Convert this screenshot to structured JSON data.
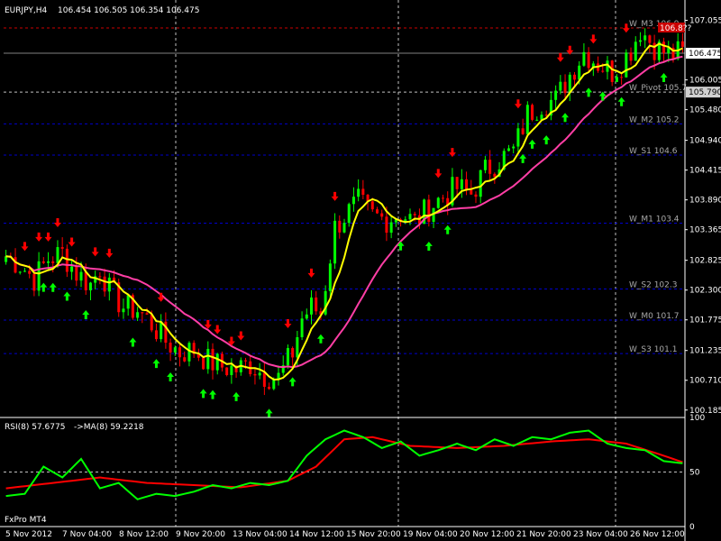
{
  "header": {
    "symbol": "EURJPY,H4",
    "ohlc": "106.454 106.505 106.354 106.475"
  },
  "rsi_panel": {
    "label": "RSI(8) 57.6775",
    "ma_label": "->MA(8) 59.2218",
    "scale": [
      "100",
      "50",
      "0"
    ]
  },
  "watermark": "FxPro MT4",
  "colors": {
    "background": "#000000",
    "grid": "#c0c0c0",
    "level_line": "#0000cc",
    "red_level": "#cc0000",
    "bull_candle": "#00ff00",
    "bear_candle": "#ff0000",
    "fast_ma": "#ffff00",
    "slow_ma": "#ff3ea5",
    "rsi": "#00ff00",
    "rsi_ma": "#ff0000",
    "up_arrow": "#00ff00",
    "down_arrow": "#ff0000"
  },
  "chart_data": {
    "type": "candlestick",
    "price_axis_ticks": [
      "107.055",
      "106.005",
      "105.480",
      "104.940",
      "104.415",
      "103.890",
      "103.365",
      "102.825",
      "102.300",
      "101.775",
      "101.235",
      "100.710",
      "100.185"
    ],
    "current_price": "106.475",
    "pivot_price": "105.790",
    "red_level_label": "106.8??",
    "x_labels": [
      "5 Nov 2012",
      "7 Nov 04:00",
      "8 Nov 12:00",
      "9 Nov 20:00",
      "13 Nov 04:00",
      "14 Nov 12:00",
      "15 Nov 20:00",
      "19 Nov 04:00",
      "20 Nov 12:00",
      "21 Nov 20:00",
      "23 Nov 04:00",
      "26 Nov 12:00"
    ],
    "levels": [
      {
        "name": "W_M3 106.9",
        "value": 106.92,
        "color": "red"
      },
      {
        "name": "W_Pivot 105.7",
        "value": 105.79,
        "color": "white"
      },
      {
        "name": "W_M2 105.2",
        "value": 105.23,
        "color": "blue"
      },
      {
        "name": "W_S1 104.6",
        "value": 104.68,
        "color": "blue"
      },
      {
        "name": "W_M1 103.4",
        "value": 103.48,
        "color": "blue"
      },
      {
        "name": "W_S2 102.3",
        "value": 102.32,
        "color": "blue"
      },
      {
        "name": "W_M0 101.7",
        "value": 101.77,
        "color": "blue"
      },
      {
        "name": "W_S3 101.1",
        "value": 101.18,
        "color": "blue"
      }
    ],
    "ylim": [
      100.07,
      107.35
    ],
    "rsi_ylim": [
      0,
      100
    ],
    "close_path": [
      [
        0,
        102.9
      ],
      [
        3,
        102.75
      ],
      [
        6,
        102.5
      ],
      [
        9,
        102.85
      ],
      [
        12,
        102.95
      ],
      [
        15,
        102.6
      ],
      [
        18,
        102.4
      ],
      [
        20,
        102.7
      ],
      [
        22,
        102.3
      ],
      [
        25,
        102.0
      ],
      [
        28,
        101.95
      ],
      [
        31,
        101.7
      ],
      [
        34,
        101.4
      ],
      [
        37,
        101.2
      ],
      [
        40,
        101.25
      ],
      [
        43,
        101.05
      ],
      [
        46,
        100.95
      ],
      [
        49,
        100.9
      ],
      [
        52,
        101.0
      ],
      [
        55,
        100.8
      ],
      [
        58,
        100.75
      ],
      [
        61,
        101.2
      ],
      [
        63,
        101.8
      ],
      [
        65,
        102.0
      ],
      [
        67,
        101.9
      ],
      [
        70,
        103.4
      ],
      [
        72,
        103.6
      ],
      [
        75,
        103.85
      ],
      [
        78,
        103.6
      ],
      [
        81,
        103.55
      ],
      [
        84,
        103.65
      ],
      [
        87,
        103.5
      ],
      [
        90,
        103.75
      ],
      [
        93,
        103.95
      ],
      [
        96,
        104.1
      ],
      [
        99,
        104.0
      ],
      [
        102,
        104.4
      ],
      [
        105,
        104.6
      ],
      [
        108,
        104.75
      ],
      [
        111,
        105.4
      ],
      [
        114,
        105.6
      ],
      [
        117,
        105.65
      ],
      [
        120,
        106.1
      ],
      [
        123,
        106.5
      ],
      [
        126,
        106.3
      ],
      [
        129,
        106.15
      ],
      [
        131,
        106.3
      ],
      [
        133,
        106.55
      ],
      [
        135,
        106.9
      ],
      [
        138,
        106.6
      ],
      [
        141,
        106.45
      ],
      [
        144,
        106.48
      ]
    ],
    "rsi_path": [
      [
        0,
        28
      ],
      [
        4,
        30
      ],
      [
        8,
        55
      ],
      [
        12,
        45
      ],
      [
        16,
        62
      ],
      [
        20,
        35
      ],
      [
        24,
        40
      ],
      [
        28,
        25
      ],
      [
        32,
        30
      ],
      [
        36,
        28
      ],
      [
        40,
        32
      ],
      [
        44,
        38
      ],
      [
        48,
        35
      ],
      [
        52,
        40
      ],
      [
        56,
        38
      ],
      [
        60,
        42
      ],
      [
        64,
        65
      ],
      [
        68,
        80
      ],
      [
        72,
        88
      ],
      [
        76,
        82
      ],
      [
        80,
        72
      ],
      [
        84,
        78
      ],
      [
        88,
        65
      ],
      [
        92,
        70
      ],
      [
        96,
        76
      ],
      [
        100,
        70
      ],
      [
        104,
        80
      ],
      [
        108,
        74
      ],
      [
        112,
        82
      ],
      [
        116,
        80
      ],
      [
        120,
        86
      ],
      [
        124,
        88
      ],
      [
        128,
        76
      ],
      [
        132,
        72
      ],
      [
        136,
        70
      ],
      [
        140,
        60
      ],
      [
        144,
        58
      ]
    ],
    "rsi_ma_path": [
      [
        0,
        35
      ],
      [
        10,
        40
      ],
      [
        20,
        45
      ],
      [
        30,
        40
      ],
      [
        40,
        38
      ],
      [
        50,
        36
      ],
      [
        60,
        42
      ],
      [
        66,
        55
      ],
      [
        72,
        80
      ],
      [
        78,
        82
      ],
      [
        86,
        74
      ],
      [
        96,
        72
      ],
      [
        106,
        74
      ],
      [
        116,
        78
      ],
      [
        124,
        80
      ],
      [
        132,
        76
      ],
      [
        140,
        65
      ],
      [
        144,
        59
      ]
    ]
  }
}
